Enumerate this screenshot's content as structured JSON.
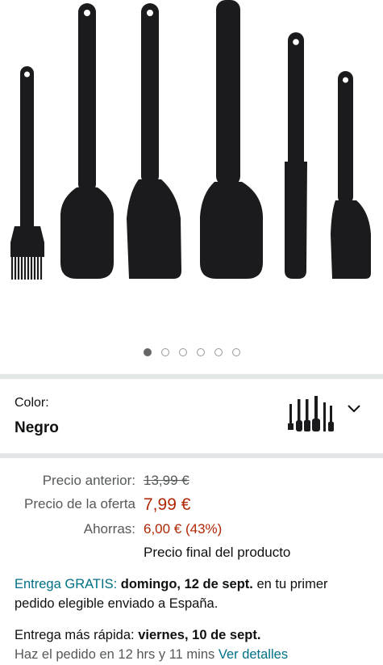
{
  "gallery": {
    "dot_count": 6,
    "active_index": 0,
    "image_alt": "Set of 6 black silicone kitchen utensils"
  },
  "variation": {
    "label": "Color:",
    "value": "Negro",
    "thumbnail_icon": "utensil-set-thumbnail",
    "dropdown_icon": "chevron-down-icon"
  },
  "pricing": {
    "previous_label": "Precio anterior:",
    "previous_value": "13,99 €",
    "offer_label": "Precio de la oferta",
    "offer_value": "7,99 €",
    "savings_label": "Ahorras:",
    "savings_value": "6,00 € (43%)",
    "final_note": "Precio final del producto"
  },
  "delivery": {
    "free_label": "Entrega GRATIS:",
    "free_date": "domingo, 12 de sept.",
    "free_suffix": "en tu primer pedido elegible enviado a España.",
    "fast_label": "Entrega más rápida:",
    "fast_date": "viernes, 10 de sept.",
    "countdown": "Haz el pedido en 12 hrs y 11 mins",
    "details_link": "Ver detalles"
  },
  "colors": {
    "price_red": "#b12704",
    "link_teal": "#007185",
    "divider": "#e3e6e6"
  }
}
